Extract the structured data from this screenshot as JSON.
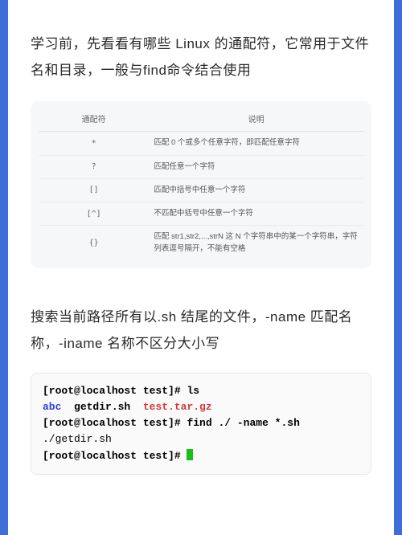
{
  "intro": "学习前，先看看有哪些 Linux 的通配符，它常用于文件名和目录，一般与find命令结合使用",
  "table": {
    "header": {
      "col1": "通配符",
      "col2": "说明"
    },
    "rows": [
      {
        "sym": "*",
        "desc": "匹配 0 个或多个任意字符，即匹配任意字符"
      },
      {
        "sym": "?",
        "desc": "匹配任意一个字符"
      },
      {
        "sym": "[]",
        "desc": "匹配中括号中任意一个字符"
      },
      {
        "sym": "[^]",
        "desc": "不匹配中括号中任意一个字符"
      },
      {
        "sym": "{}",
        "desc": "匹配 str1,str2,...,strN 这 N 个字符串中的某一个字符串，字符列表逗号隔开，不能有空格"
      }
    ]
  },
  "midtext": "搜索当前路径所有以.sh 结尾的文件，-name 匹配名称，-iname 名称不区分大小写",
  "terminal": {
    "prompt": "[root@localhost test]#",
    "ls_cmd": "ls",
    "ls_out": {
      "dir": "abc",
      "file1": "getdir.sh",
      "file2": "test.tar.gz"
    },
    "find_cmd": "find ./ -name *.sh",
    "find_out": "./getdir.sh"
  }
}
